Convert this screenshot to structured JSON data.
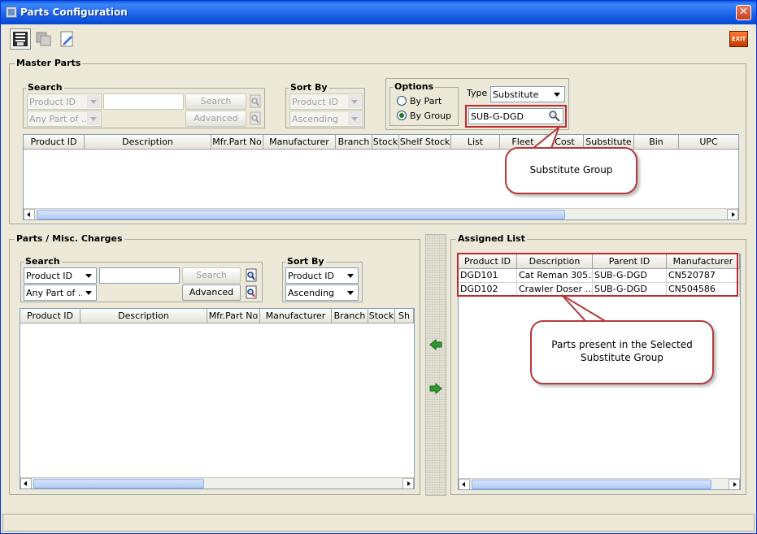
{
  "window": {
    "title": "Parts Configuration",
    "exit_label": "EXIT",
    "close_symbol": "✕"
  },
  "master_parts": {
    "group_title": "Master Parts",
    "search": {
      "title": "Search",
      "field_combo": "Product ID",
      "match_combo": "Any Part of ...",
      "search_button": "Search",
      "advanced_button": "Advanced"
    },
    "sort_by": {
      "title": "Sort By",
      "field_combo": "Product ID",
      "order_combo": "Ascending"
    },
    "options": {
      "title": "Options",
      "by_part": "By Part",
      "by_group": "By Group",
      "type_label": "Type",
      "type_value": "Substitute",
      "group_value": "SUB-G-DGD"
    },
    "columns": [
      "Product ID",
      "Description",
      "Mfr.Part No",
      "Manufacturer",
      "Branch",
      "Stock",
      "Shelf Stock",
      "List",
      "Fleet",
      "Cost",
      "Substitute",
      "Bin",
      "UPC"
    ]
  },
  "parts_misc": {
    "group_title": "Parts / Misc. Charges",
    "search": {
      "title": "Search",
      "field_combo": "Product ID",
      "match_combo": "Any Part of ...",
      "search_button": "Search",
      "advanced_button": "Advanced"
    },
    "sort_by": {
      "title": "Sort By",
      "field_combo": "Product ID",
      "order_combo": "Ascending"
    },
    "columns": [
      "Product ID",
      "Description",
      "Mfr.Part No",
      "Manufacturer",
      "Branch",
      "Stock",
      "Sh"
    ]
  },
  "assigned_list": {
    "group_title": "Assigned List",
    "columns": [
      "Product ID",
      "Description",
      "Parent ID",
      "Manufacturer"
    ],
    "rows": [
      [
        "DGD101",
        "Cat Reman 305...",
        "SUB-G-DGD",
        "CN520787"
      ],
      [
        "DGD102",
        "Crawler Doser ...",
        "SUB-G-DGD",
        "CN504586"
      ]
    ]
  },
  "callouts": {
    "substitute_group": "Substitute Group",
    "parts_present_line1": "Parts present in the Selected",
    "parts_present_line2": "Substitute Group"
  },
  "colors": {
    "title_bar": "#1b62e8",
    "callout_border": "#b33a3a",
    "highlight_border": "#c0282d",
    "transfer_arrow": "#2e9a2e"
  }
}
